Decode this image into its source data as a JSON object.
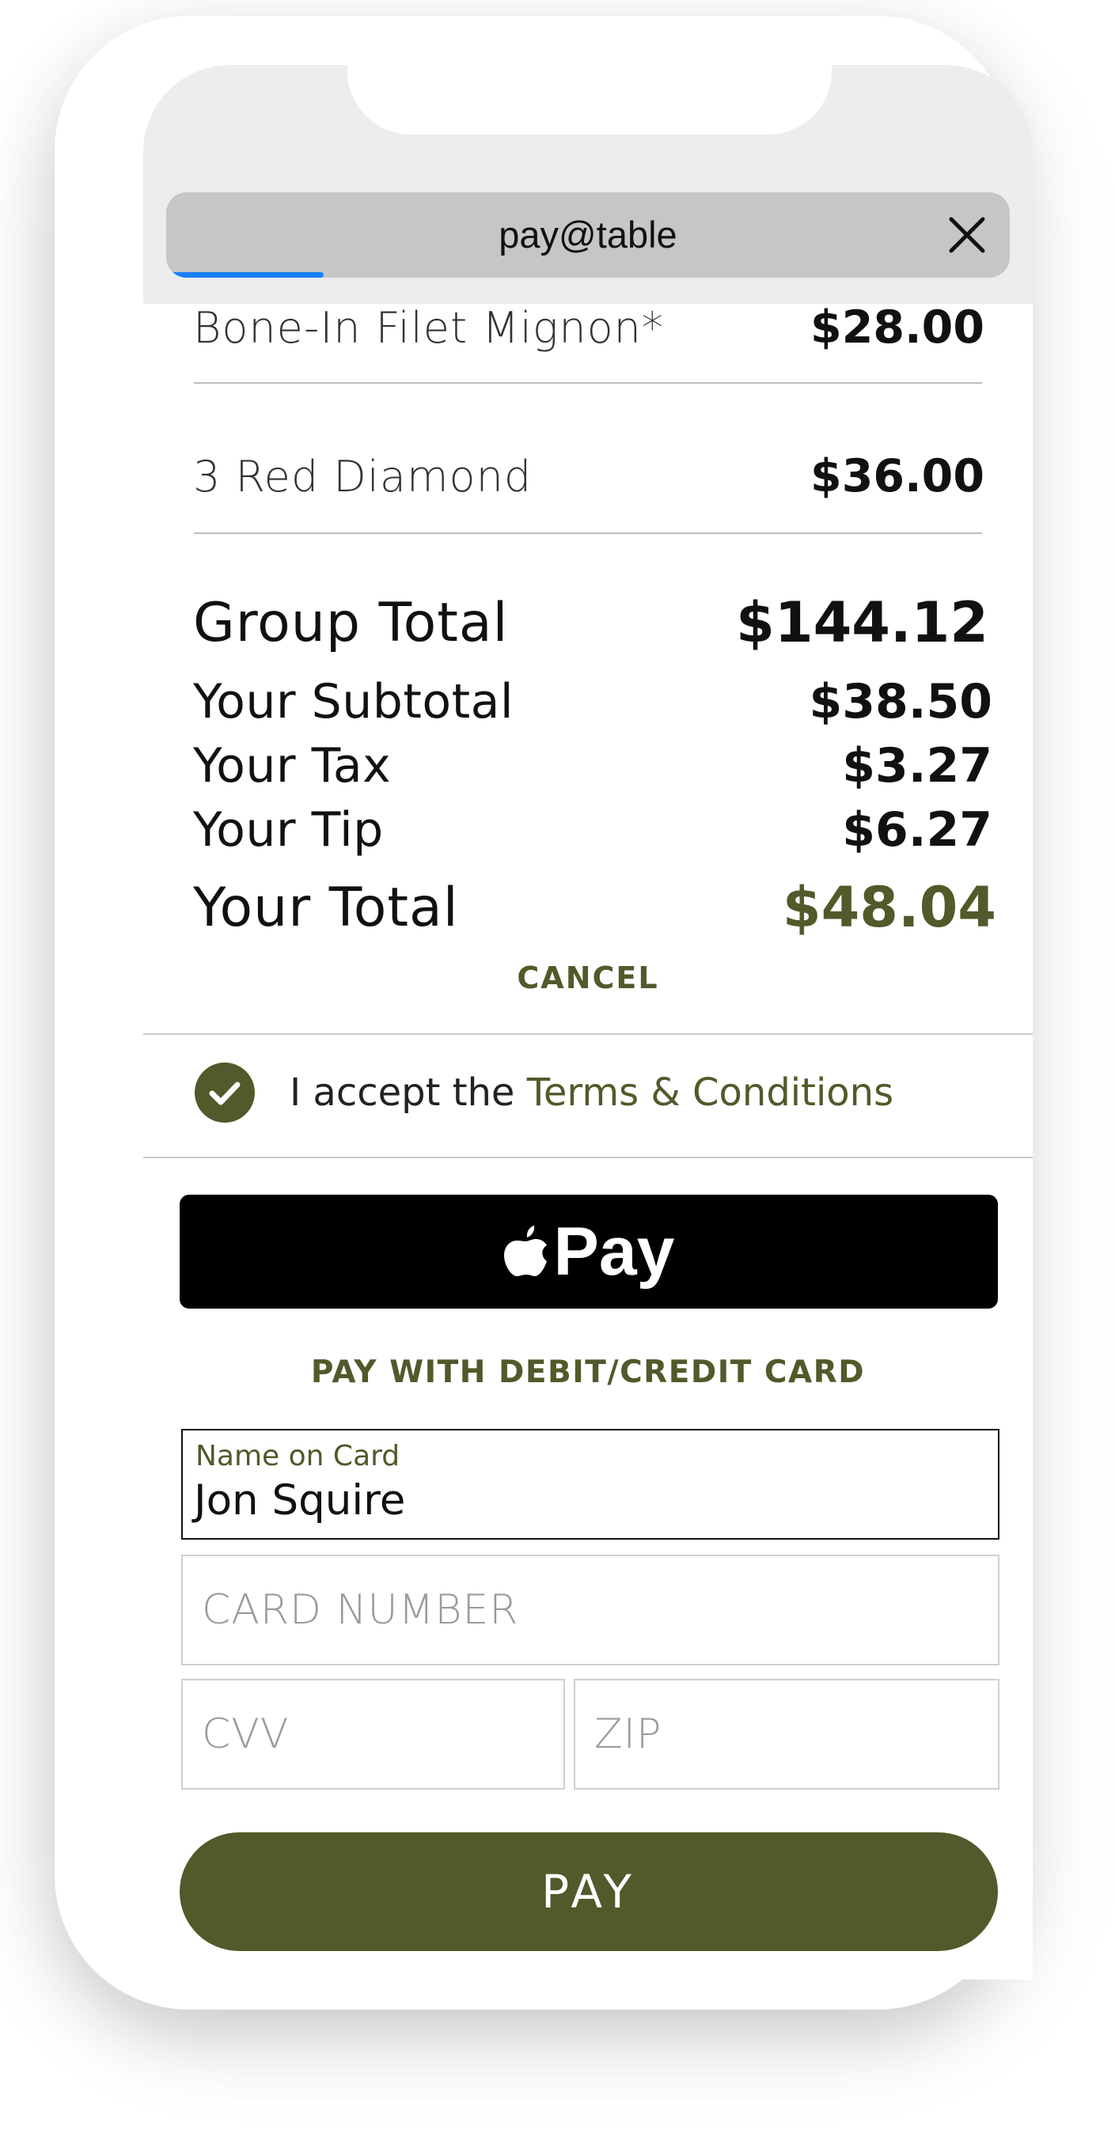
{
  "browser": {
    "url_title": "pay@table",
    "load_progress": 0.18
  },
  "order_items": [
    {
      "name": "Bone-In Filet Mignon*",
      "price": "$28.00"
    },
    {
      "name": "3 Red Diamond",
      "price": "$36.00"
    }
  ],
  "summary": {
    "group_total_label": "Group Total",
    "group_total_value": "$144.12",
    "subtotal_label": "Your Subtotal",
    "subtotal_value": "$38.50",
    "tax_label": "Your Tax",
    "tax_value": "$3.27",
    "tip_label": "Your Tip",
    "tip_value": "$6.27",
    "total_label": "Your Total",
    "total_value": "$48.04"
  },
  "cancel_label": "CANCEL",
  "terms": {
    "accepted": true,
    "prefix": "I accept the",
    "link_text": "Terms & Conditions"
  },
  "apple_pay_label": "Pay",
  "card_section_heading": "PAY WITH DEBIT/CREDIT CARD",
  "card_form": {
    "name_label": "Name on Card",
    "name_value": "Jon Squire",
    "card_number_placeholder": "CARD NUMBER",
    "cvv_placeholder": "CVV",
    "zip_placeholder": "ZIP"
  },
  "pay_button_label": "PAY",
  "colors": {
    "accent": "#52592a",
    "progress": "#1a7ff7",
    "apple_pay_bg": "#000000"
  }
}
